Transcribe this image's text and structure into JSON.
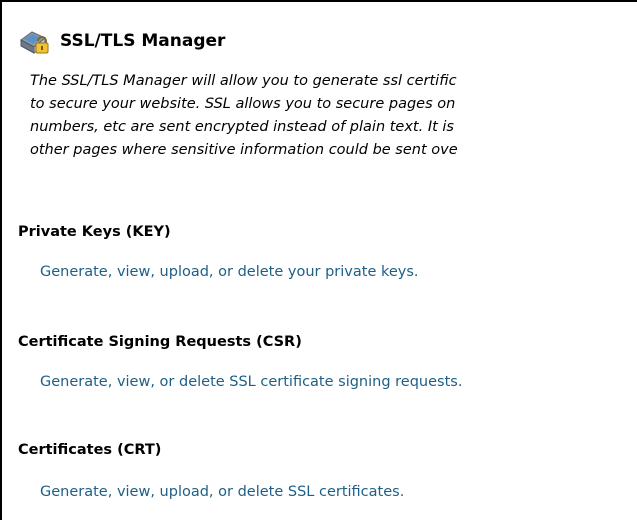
{
  "header": {
    "title": "SSL/TLS Manager",
    "icon": "ssl-lock-icon"
  },
  "intro": {
    "lines": [
      "The SSL/TLS Manager will allow you to generate ssl certific",
      "to secure your website. SSL allows you to secure pages on",
      "numbers, etc are sent encrypted instead of plain text. It is",
      "other pages where sensitive information could be sent ove"
    ]
  },
  "sections": [
    {
      "heading": "Private Keys (KEY)",
      "link": "Generate, view, upload, or delete your private keys."
    },
    {
      "heading": "Certificate Signing Requests (CSR)",
      "link": "Generate, view, or delete SSL certificate signing requests."
    },
    {
      "heading": "Certificates (CRT)",
      "link": "Generate, view, upload, or delete SSL certificates."
    }
  ],
  "colors": {
    "link": "#1e5f86",
    "text": "#000000",
    "background": "#ffffff"
  }
}
